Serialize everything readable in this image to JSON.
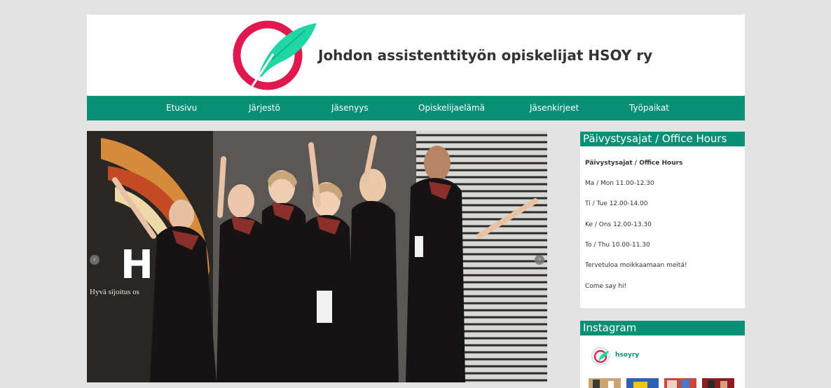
{
  "site": {
    "title": "Johdon assistenttityön opiskelijat HSOY ry"
  },
  "nav": {
    "items": [
      {
        "label": "Etusivu"
      },
      {
        "label": "Järjestö"
      },
      {
        "label": "Jäsenyys"
      },
      {
        "label": "Opiskelijaelämä"
      },
      {
        "label": "Jäsenkirjeet"
      },
      {
        "label": "Työpaikat"
      }
    ]
  },
  "slider": {
    "banner_text": "HS",
    "banner_tagline": "Hyvä sijoitus os",
    "prev_icon": "‹",
    "next_icon": "›"
  },
  "office_hours": {
    "title": "Päivystysajat / Office Hours",
    "heading": "Päivystysajat / Office Hours",
    "lines": [
      "Ma / Mon  11.00-12.30",
      "Ti / Tue  12.00-14.00",
      "Ke / Ons  12.00-13.30",
      "To / Thu  10.00-11.30",
      "Tervetuloa moikkaamaan meitä!",
      "Come say hi!"
    ]
  },
  "instagram": {
    "title": "Instagram",
    "username": "hsoyry"
  },
  "colors": {
    "brand_green": "#079076",
    "logo_red": "#e0184f",
    "logo_mint": "#1fd6a4",
    "page_bg": "#e3e3e3"
  },
  "icons": {
    "logo": "feather-circle-logo",
    "prev": "chevron-left-icon",
    "next": "chevron-right-icon"
  }
}
